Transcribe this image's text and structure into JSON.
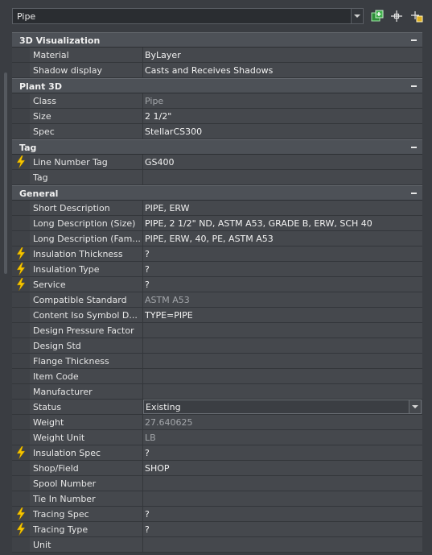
{
  "selector": {
    "value": "Pipe"
  },
  "toolbar": {
    "quick_select_icon": "quick-select-icon",
    "pick_icon": "pick-objects-icon",
    "toggle_pickadd_icon": "pickadd-toggle-icon"
  },
  "colors": {
    "background": "#3a3d42",
    "section": "#4d5157",
    "row": "#45484d",
    "bolt": "#f5c400"
  },
  "sections": [
    {
      "title": "3D Visualization",
      "rows": [
        {
          "label": "Material",
          "value": "ByLayer"
        },
        {
          "label": "Shadow display",
          "value": "Casts and Receives Shadows"
        }
      ]
    },
    {
      "title": "Plant 3D",
      "rows": [
        {
          "label": "Class",
          "value": "Pipe",
          "muted": true
        },
        {
          "label": "Size",
          "value": "2 1/2\""
        },
        {
          "label": "Spec",
          "value": "StellarCS300"
        }
      ]
    },
    {
      "title": "Tag",
      "rows": [
        {
          "label": "Line Number Tag",
          "value": "GS400",
          "bolt": true
        },
        {
          "label": "Tag",
          "value": ""
        }
      ]
    },
    {
      "title": "General",
      "rows": [
        {
          "label": "Short Description",
          "value": "PIPE, ERW"
        },
        {
          "label": "Long Description (Size)",
          "value": "PIPE, 2 1/2\" ND, ASTM A53, GRADE B, ERW, SCH 40"
        },
        {
          "label": "Long Description (Fam...",
          "value": "PIPE, ERW, 40, PE, ASTM A53"
        },
        {
          "label": "Insulation Thickness",
          "value": "?",
          "bolt": true
        },
        {
          "label": "Insulation Type",
          "value": "?",
          "bolt": true
        },
        {
          "label": "Service",
          "value": "?",
          "bolt": true
        },
        {
          "label": "Compatible Standard",
          "value": "ASTM A53",
          "muted": true
        },
        {
          "label": "Content Iso Symbol D...",
          "value": "TYPE=PIPE"
        },
        {
          "label": "Design Pressure Factor",
          "value": ""
        },
        {
          "label": "Design Std",
          "value": ""
        },
        {
          "label": "Flange Thickness",
          "value": ""
        },
        {
          "label": "Item Code",
          "value": ""
        },
        {
          "label": "Manufacturer",
          "value": ""
        },
        {
          "label": "Status",
          "value": "Existing",
          "select": true
        },
        {
          "label": "Weight",
          "value": "27.640625",
          "muted": true
        },
        {
          "label": "Weight Unit",
          "value": "LB",
          "muted": true
        },
        {
          "label": "Insulation Spec",
          "value": "?",
          "bolt": true
        },
        {
          "label": "Shop/Field",
          "value": "SHOP"
        },
        {
          "label": "Spool Number",
          "value": ""
        },
        {
          "label": "Tie In Number",
          "value": ""
        },
        {
          "label": "Tracing Spec",
          "value": "?",
          "bolt": true
        },
        {
          "label": "Tracing Type",
          "value": "?",
          "bolt": true
        },
        {
          "label": "Unit",
          "value": ""
        }
      ]
    }
  ]
}
